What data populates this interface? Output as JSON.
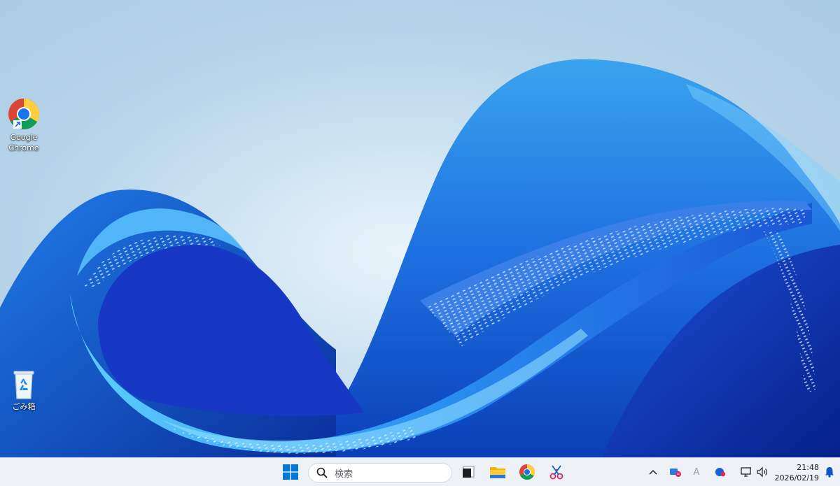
{
  "desktop": {
    "icons": [
      {
        "name": "chrome-shortcut",
        "label": "Google\nChrome",
        "icon": "chrome-icon"
      },
      {
        "name": "recycle-bin",
        "label": "ごみ箱",
        "icon": "recycle-bin-icon"
      }
    ]
  },
  "taskbar": {
    "start_icon": "windows-logo-icon",
    "search": {
      "placeholder": "検索",
      "icon": "search-icon"
    },
    "apps": [
      {
        "name": "taskbar-app-widget",
        "icon": "dark-window-icon"
      },
      {
        "name": "taskbar-app-file-explorer",
        "icon": "folder-icon"
      },
      {
        "name": "taskbar-app-chrome",
        "icon": "chrome-icon"
      },
      {
        "name": "taskbar-app-snipping",
        "icon": "snipping-tool-icon"
      }
    ],
    "tray": {
      "chevron": "^",
      "ime": "A",
      "icons": [
        "onedrive-icon",
        "network-icon",
        "volume-icon",
        "notification-bell-icon"
      ]
    },
    "clock": {
      "time": "21:48",
      "date": "2026/02/19"
    }
  },
  "colors": {
    "accent_blue": "#0067c0",
    "windows_logo": "#0078d4",
    "taskbar_bg": "#eef1f5"
  }
}
